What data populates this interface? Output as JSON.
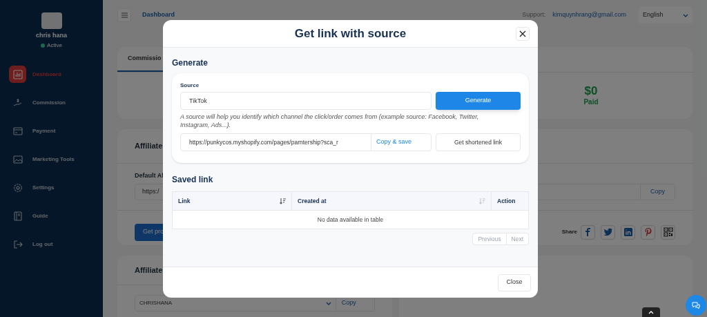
{
  "sidebar": {
    "user": {
      "name": "chris hana",
      "status": "Active"
    },
    "items": [
      {
        "label": "Dashboard",
        "selected": true
      },
      {
        "label": "Commission",
        "selected": false
      },
      {
        "label": "Payment",
        "selected": false
      },
      {
        "label": "Marketing Tools",
        "selected": false
      },
      {
        "label": "Settings",
        "selected": false
      },
      {
        "label": "Guide",
        "selected": false
      },
      {
        "label": "Log out",
        "selected": false
      }
    ]
  },
  "topbar": {
    "breadcrumb": "Dashboard",
    "support_label": "Support:",
    "support_email": "kimquynhrang@gmail.com",
    "language": "English"
  },
  "background": {
    "commission_card": {
      "tab": "Commissio",
      "amount": "$0",
      "amount_label": "Paid"
    },
    "affiliate_link_card": {
      "title": "Affiliate",
      "field_label": "Default Af",
      "field_value": "https:/",
      "copy_button": "Copy",
      "button": "Get pro",
      "share_label": "Share"
    },
    "affiliate_code_card": {
      "title": "Affiliate",
      "select_value": "CHRISHANA",
      "copy_button": "Copy"
    }
  },
  "modal": {
    "title": "Get link with source",
    "generate": {
      "heading": "Generate",
      "source_label": "Source",
      "source_value": "TikTok",
      "generate_button": "Generate",
      "hint": "A source will help you identify which channel the click/order comes from (example source: Facebook, Twitter, Instagram, Ads...).",
      "link_value": "https://punkycos.myshopify.com/pages/parntership?sca_r",
      "copy_save_button": "Copy & save",
      "shorten_button": "Get shortened link"
    },
    "saved": {
      "heading": "Saved link",
      "columns": [
        {
          "label": "Link",
          "sortable": true,
          "sorted": true
        },
        {
          "label": "Created at",
          "sortable": true,
          "sorted": false
        },
        {
          "label": "Action",
          "sortable": false
        }
      ],
      "empty_message": "No data available in table",
      "pagination": [
        {
          "label": "Previous",
          "disabled": true
        },
        {
          "label": "Next",
          "disabled": true
        }
      ]
    },
    "close_button": "Close"
  }
}
